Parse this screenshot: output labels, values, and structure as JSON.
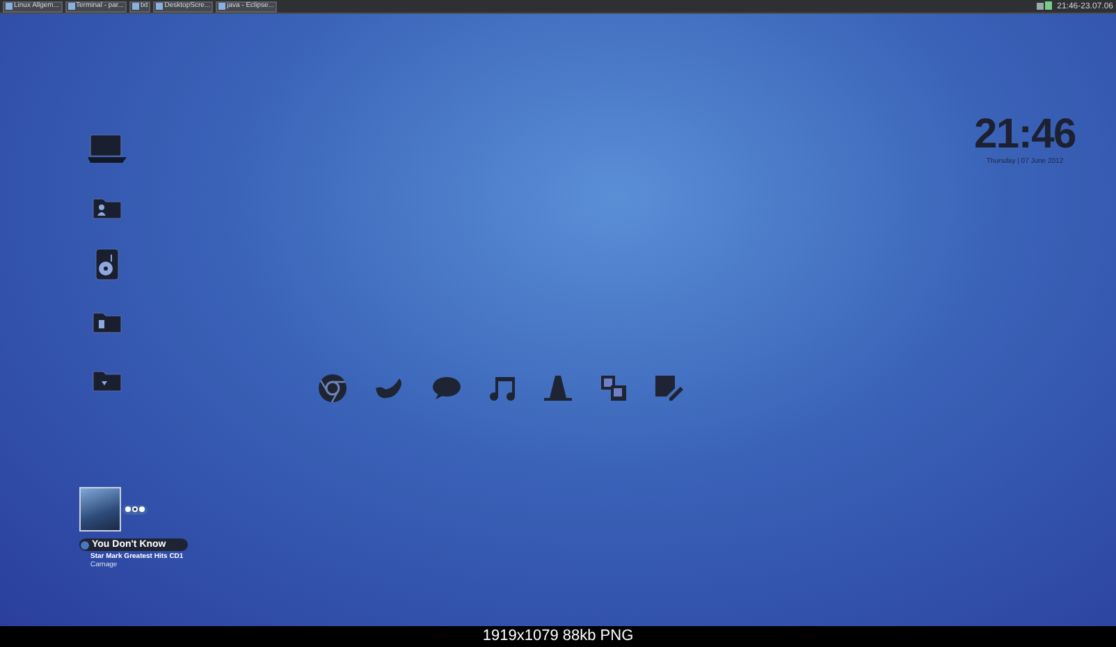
{
  "taskbar": {
    "tasks": [
      {
        "label": "Linux Allgem..."
      },
      {
        "label": "Terminal - par..."
      },
      {
        "label": "txt"
      },
      {
        "label": "DesktopScre..."
      },
      {
        "label": "java - Eclipse..."
      }
    ],
    "clock": "21:46-23.07.06"
  },
  "clock_widget": {
    "time": "21:46",
    "date": "Thursday | 07 June 2012"
  },
  "media_player": {
    "title": "You Don't Know",
    "album": "Star Mark Greatest Hits CD1",
    "artist": "Carnage"
  },
  "caption": "1919x1079 88kb PNG"
}
